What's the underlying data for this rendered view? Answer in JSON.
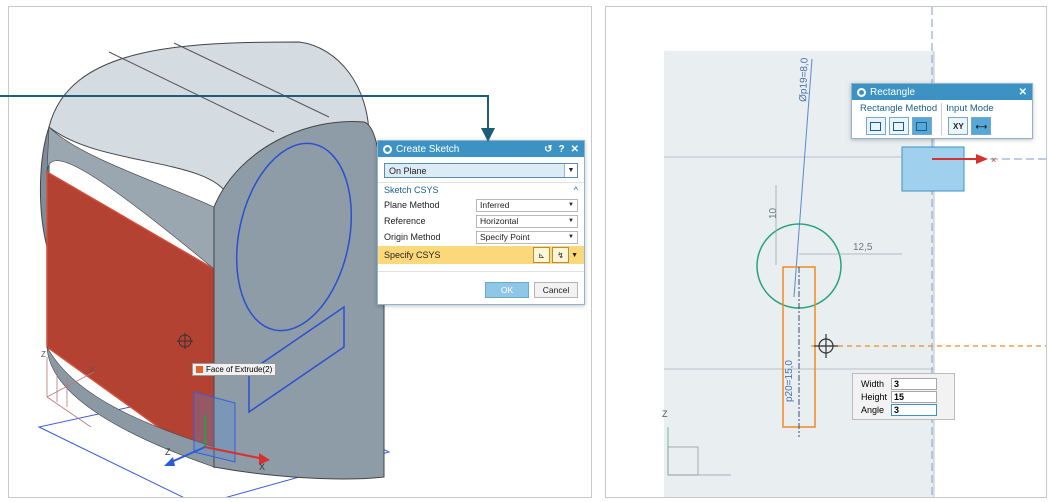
{
  "left_view": {
    "face_tag": "Face of Extrude(2)",
    "triad_labels": {
      "z": "Z",
      "x": "X",
      "y": "Y"
    },
    "colors": {
      "selected_face": "#b44232",
      "body": "#8a98a3",
      "sketch_curve": "#2a4fd0",
      "callout": "#1f5c7a"
    }
  },
  "create_sketch": {
    "title": "Create Sketch",
    "title_buttons": [
      "↺",
      "?",
      "✕"
    ],
    "type_value": "On Plane",
    "section_title": "Sketch CSYS",
    "rows": [
      {
        "label": "Plane Method",
        "value": "Inferred"
      },
      {
        "label": "Reference",
        "value": "Horizontal"
      },
      {
        "label": "Origin Method",
        "value": "Specify Point"
      }
    ],
    "specify_label": "Specify CSYS",
    "ok_label": "OK",
    "cancel_label": "Cancel"
  },
  "rectangle_dialog": {
    "title": "Rectangle",
    "close": "✕",
    "method_label": "Rectangle Method",
    "input_label": "Input Mode",
    "xy_label": "XY"
  },
  "sketch": {
    "dim_diameter": "Øp19=8,0",
    "dim_vertical": "10",
    "dim_horizontal": "12,5",
    "dim_height": "p20=15,0",
    "axis_z": "Z"
  },
  "input_box": {
    "width_label": "Width",
    "width_value": "3",
    "height_label": "Height",
    "height_value": "15",
    "angle_label": "Angle",
    "angle_value": "3"
  }
}
